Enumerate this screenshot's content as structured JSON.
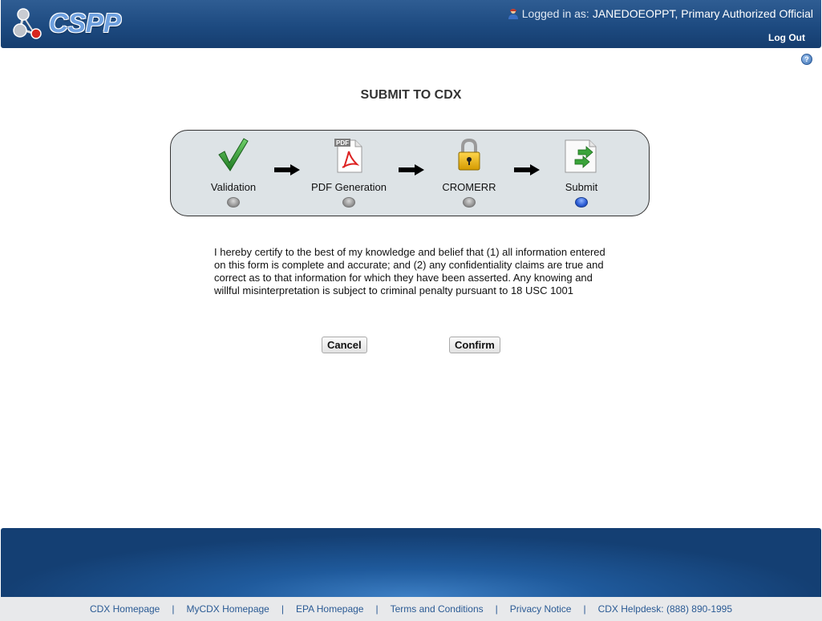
{
  "header": {
    "logo_text": "CSPP",
    "logged_in_label": "Logged in as:",
    "user": "JANEDOEOPPT, Primary Authorized Official",
    "logout": "Log Out",
    "help": "?"
  },
  "title": "SUBMIT TO CDX",
  "steps": [
    {
      "label": "Validation",
      "icon": "checkmark-icon",
      "active": false
    },
    {
      "label": "PDF Generation",
      "icon": "pdf-icon",
      "active": false
    },
    {
      "label": "CROMERR",
      "icon": "padlock-icon",
      "active": false
    },
    {
      "label": "Submit",
      "icon": "submit-document-icon",
      "active": true
    }
  ],
  "pdf_badge": "PDF",
  "certification": "I hereby certify to the best of my knowledge and belief that (1) all information entered on this form is complete and accurate; and (2) any confidentiality claims are true and correct as to that information for which they have been asserted. Any knowing and willful misinterpretation is subject to criminal penalty pursuant to 18 USC 1001",
  "buttons": {
    "cancel": "Cancel",
    "confirm": "Confirm"
  },
  "footer": {
    "links": [
      "CDX Homepage",
      "MyCDX Homepage",
      "EPA Homepage",
      "Terms and Conditions",
      "Privacy Notice",
      "CDX Helpdesk: (888) 890-1995"
    ],
    "separator": "|"
  },
  "colors": {
    "header": "#1d4a80",
    "step_bg": "#dde3e6",
    "active_dot": "#2a5bd4",
    "link": "#2a5a94"
  }
}
